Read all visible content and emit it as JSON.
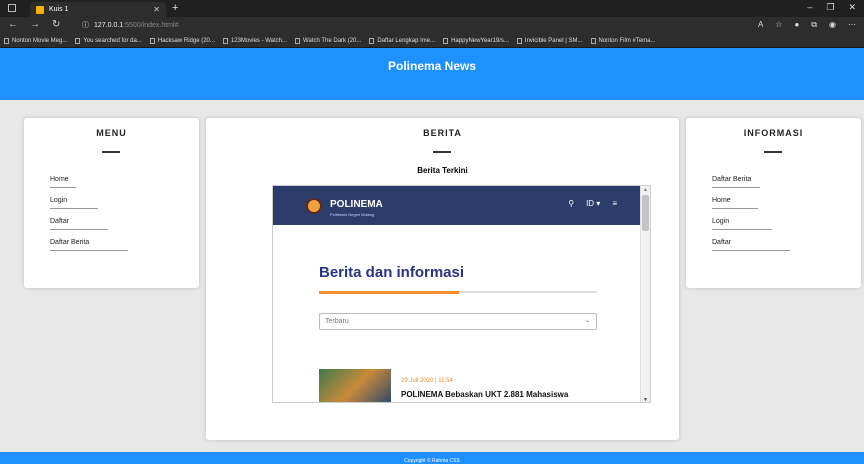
{
  "browser": {
    "tab_title": "Kuis 1",
    "url_host": "127.0.0.1",
    "url_rest": ":5500/index.html#",
    "bookmarks": [
      "Nonton Movie Meg...",
      "You searched for da...",
      "Hacksaw Ridge (20...",
      "123Movies - Watch...",
      "Watch The Dark (20...",
      "Daftar Lengkap Ime...",
      "HappyNewYear19/s...",
      "Invicible Panel | SM...",
      "Nonton Film #Tema..."
    ]
  },
  "header": {
    "title": "Polinema News"
  },
  "menu": {
    "title": "MENU",
    "items": [
      "Home",
      "Login",
      "Daftar",
      "Daftar Berita"
    ]
  },
  "berita": {
    "title": "BERITA",
    "subtitle": "Berita Terkini",
    "embed": {
      "brand": "POLINEMA",
      "brand_sub": "Politeknik Negeri Malang",
      "lang": "ID",
      "heading": "Berita dan informasi",
      "select_value": "Terbaru",
      "news": [
        {
          "date": "29 Juli 2020 | 11:54",
          "title": "POLINEMA Bebaskan UKT 2.881 Mahasiswa"
        }
      ]
    }
  },
  "informasi": {
    "title": "INFORMASI",
    "items": [
      "Daftar Berita",
      "Home",
      "Login",
      "Daftar"
    ]
  },
  "footer": {
    "text": "Copyright © Rahma CSS"
  },
  "colors": {
    "accent": "#1e90ff",
    "polinema_navy": "#2c3d6b",
    "orange": "#f28c28"
  }
}
